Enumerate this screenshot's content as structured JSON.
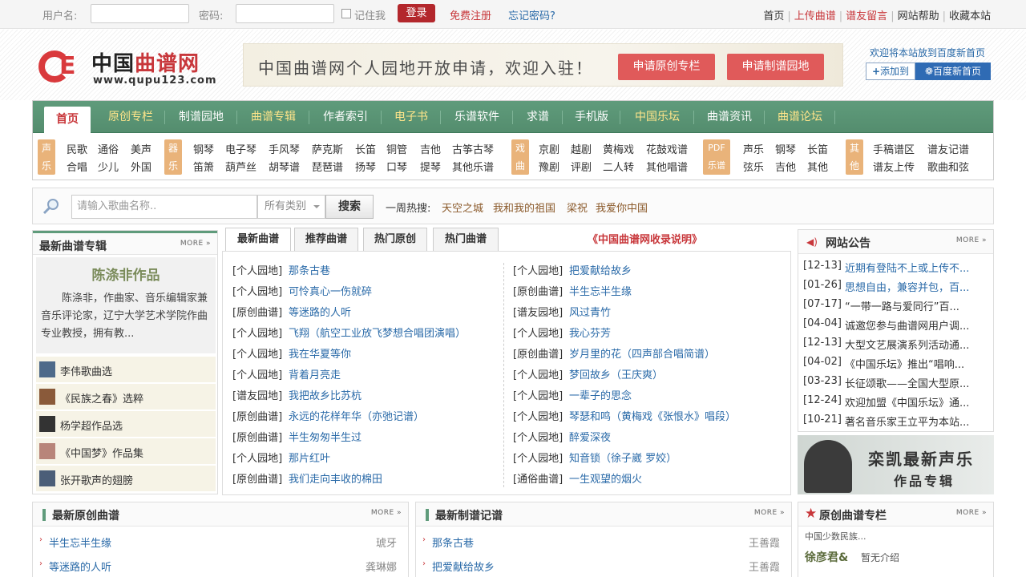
{
  "topbar": {
    "username_label": "用户名:",
    "password_label": "密码:",
    "remember_label": "记住我",
    "login_label": "登录",
    "register_label": "免费注册",
    "forgot_label": "忘记密码?",
    "links": [
      "首页",
      "上传曲谱",
      "谱友留言",
      "网站帮助",
      "收藏本站"
    ]
  },
  "header": {
    "logo_cn_a": "中国",
    "logo_cn_b": "曲谱网",
    "logo_url": "www.qupu123.com",
    "banner_text": "中国曲谱网个人园地开放申请，欢迎入驻！",
    "banner_btn1": "申请原创专栏",
    "banner_btn2": "申请制谱园地",
    "fav_text": "欢迎将本站放到百度新首页",
    "fav_add": "添加到",
    "fav_baidu": "百度新首页"
  },
  "nav": {
    "items": [
      "首页",
      "原创专栏",
      "制谱园地",
      "曲谱专辑",
      "作者索引",
      "电子书",
      "乐谱软件",
      "求谱",
      "手机版",
      "中国乐坛",
      "曲谱资讯",
      "曲谱论坛"
    ]
  },
  "subnav": {
    "g1_cat": [
      "声",
      "乐"
    ],
    "g1": [
      "民歌",
      "通俗",
      "美声",
      "合唱",
      "少儿",
      "外国"
    ],
    "g2_cat": [
      "器",
      "乐"
    ],
    "g2": [
      "钢琴",
      "电子琴",
      "手风琴",
      "萨克斯",
      "长笛",
      "铜管",
      "吉他",
      "古筝古琴",
      "笛箫",
      "葫芦丝",
      "胡琴谱",
      "琵琶谱",
      "扬琴",
      "口琴",
      "提琴",
      "其他乐谱"
    ],
    "g3_cat": [
      "戏",
      "曲"
    ],
    "g3": [
      "京剧",
      "越剧",
      "黄梅戏",
      "花鼓戏谱",
      "豫剧",
      "评剧",
      "二人转",
      "其他唱谱"
    ],
    "g4_cat": [
      "PDF",
      "乐谱"
    ],
    "g4": [
      "声乐",
      "钢琴",
      "长笛",
      "弦乐",
      "吉他",
      "其他"
    ],
    "g5_cat": [
      "其",
      "他"
    ],
    "g5": [
      "手稿谱区",
      "谱友记谱",
      "谱友上传",
      "歌曲和弦"
    ]
  },
  "search": {
    "placeholder": "请输入歌曲名称..",
    "category": "所有类别",
    "button": "搜索",
    "hot_label": "一周热搜:",
    "hot_words": [
      "天空之城",
      "我和我的祖国",
      "梁祝",
      "我爱你中国"
    ]
  },
  "album": {
    "title": "最新曲谱专辑",
    "more": "MORE »",
    "author": "陈涤非作品",
    "desc": "陈涤非，作曲家、音乐编辑家兼音乐评论家，辽宁大学艺术学院作曲专业教授，拥有教...",
    "people": [
      "李伟歌曲选",
      "《民族之春》选粹",
      "杨学超作品选",
      "《中国梦》作品集",
      "张开歌声的翅膀"
    ]
  },
  "center": {
    "tabs": [
      "最新曲谱",
      "推荐曲谱",
      "热门原创",
      "热门曲谱"
    ],
    "notice": "《中国曲谱网收录说明》",
    "left": [
      {
        "tag": "[个人园地]",
        "t": "那条古巷"
      },
      {
        "tag": "[个人园地]",
        "t": "可怜真心一伤就碎"
      },
      {
        "tag": "[原创曲谱]",
        "t": "等迷路的人听"
      },
      {
        "tag": "[个人园地]",
        "t": "飞翔（航空工业放飞梦想合唱团演唱）"
      },
      {
        "tag": "[个人园地]",
        "t": "我在华夏等你"
      },
      {
        "tag": "[个人园地]",
        "t": "背着月亮走"
      },
      {
        "tag": "[谱友园地]",
        "t": "我把故乡比苏杭"
      },
      {
        "tag": "[原创曲谱]",
        "t": "永远的花样年华（亦弛记谱）"
      },
      {
        "tag": "[原创曲谱]",
        "t": "半生匆匆半生过"
      },
      {
        "tag": "[个人园地]",
        "t": "那片红叶"
      },
      {
        "tag": "[原创曲谱]",
        "t": "我们走向丰收的棉田"
      }
    ],
    "right": [
      {
        "tag": "[个人园地]",
        "t": "把爱献给故乡"
      },
      {
        "tag": "[原创曲谱]",
        "t": "半生忘半生缘"
      },
      {
        "tag": "[谱友园地]",
        "t": "风过青竹"
      },
      {
        "tag": "[个人园地]",
        "t": "我心芬芳"
      },
      {
        "tag": "[原创曲谱]",
        "t": "岁月里的花（四声部合唱简谱）"
      },
      {
        "tag": "[个人园地]",
        "t": "梦回故乡（王庆爽）"
      },
      {
        "tag": "[个人园地]",
        "t": "一辈子的思念"
      },
      {
        "tag": "[个人园地]",
        "t": "琴瑟和鸣（黄梅戏《张恨水》唱段）"
      },
      {
        "tag": "[个人园地]",
        "t": "醉爱深夜"
      },
      {
        "tag": "[个人园地]",
        "t": "知音锁（徐子崴 罗姣）"
      },
      {
        "tag": "[通俗曲谱]",
        "t": "一生观望的烟火"
      }
    ]
  },
  "notice": {
    "title": "网站公告",
    "more": "MORE »",
    "items": [
      {
        "d": "[12-13]",
        "t": "近期有登陆不上或上传不...",
        "hl": true
      },
      {
        "d": "[01-26]",
        "t": "思想自由，兼容并包，百...",
        "hl": true
      },
      {
        "d": "[07-17]",
        "t": "“一带一路与爱同行”百...",
        "hl": false
      },
      {
        "d": "[04-04]",
        "t": "诚邀您参与曲谱网用户调...",
        "hl": false
      },
      {
        "d": "[12-13]",
        "t": "大型文艺展演系列活动通...",
        "hl": false
      },
      {
        "d": "[04-02]",
        "t": "《中国乐坛》推出“唱响...",
        "hl": false
      },
      {
        "d": "[03-23]",
        "t": "长征颂歌——全国大型原...",
        "hl": false
      },
      {
        "d": "[12-24]",
        "t": "欢迎加盟《中国乐坛》通...",
        "hl": false
      },
      {
        "d": "[10-21]",
        "t": "著名音乐家王立平为本站...",
        "hl": false
      }
    ],
    "promo1": "栾凯最新声乐",
    "promo2": "作品专辑"
  },
  "bottom": {
    "orig_title": "最新原创曲谱",
    "orig_more": "MORE »",
    "orig_items": [
      {
        "t": "半生忘半生缘",
        "a": "琥牙"
      },
      {
        "t": "等迷路的人听",
        "a": "龚琳娜"
      }
    ],
    "zp_title": "最新制谱记谱",
    "zp_more": "MORE »",
    "zp_items": [
      {
        "t": "那条古巷",
        "a": "王善霞"
      },
      {
        "t": "把爱献给故乡",
        "a": "王善霞"
      }
    ],
    "col_title": "原创曲谱专栏",
    "col_more": "MORE »",
    "col_sub": "中国少数民族...",
    "col_name": "徐彦君&",
    "col_intro": "暂无介绍"
  },
  "colors": {
    "accent": "#5f9b7b",
    "brand": "#c8373b",
    "link": "#2a6aa8"
  }
}
